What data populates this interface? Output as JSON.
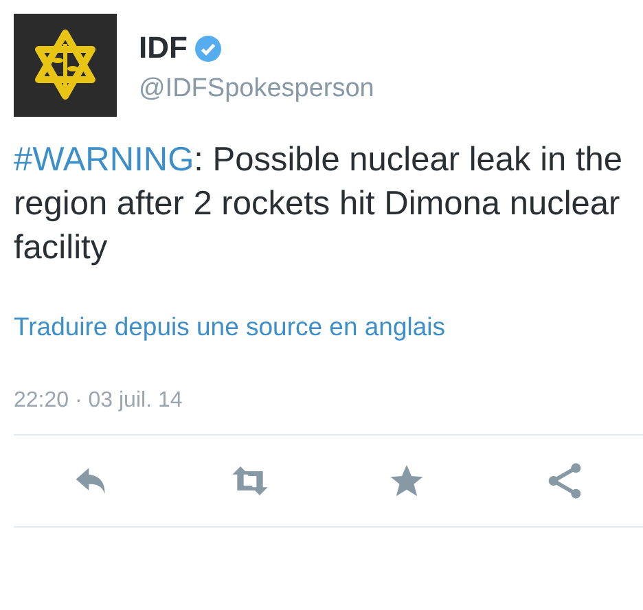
{
  "author": {
    "name": "IDF",
    "verified": true,
    "handle": "@IDFSpokesperson"
  },
  "tweet": {
    "hashtag": "#WARNING",
    "text": ": Possible nuclear leak in the region after 2 rockets hit Dimona nuclear facility"
  },
  "translate_link": "Traduire depuis une source en anglais",
  "timestamp": "22:20 · 03 juil. 14",
  "actions": [
    {
      "kind": "reply"
    },
    {
      "kind": "retweet"
    },
    {
      "kind": "favorite"
    },
    {
      "kind": "share"
    }
  ]
}
